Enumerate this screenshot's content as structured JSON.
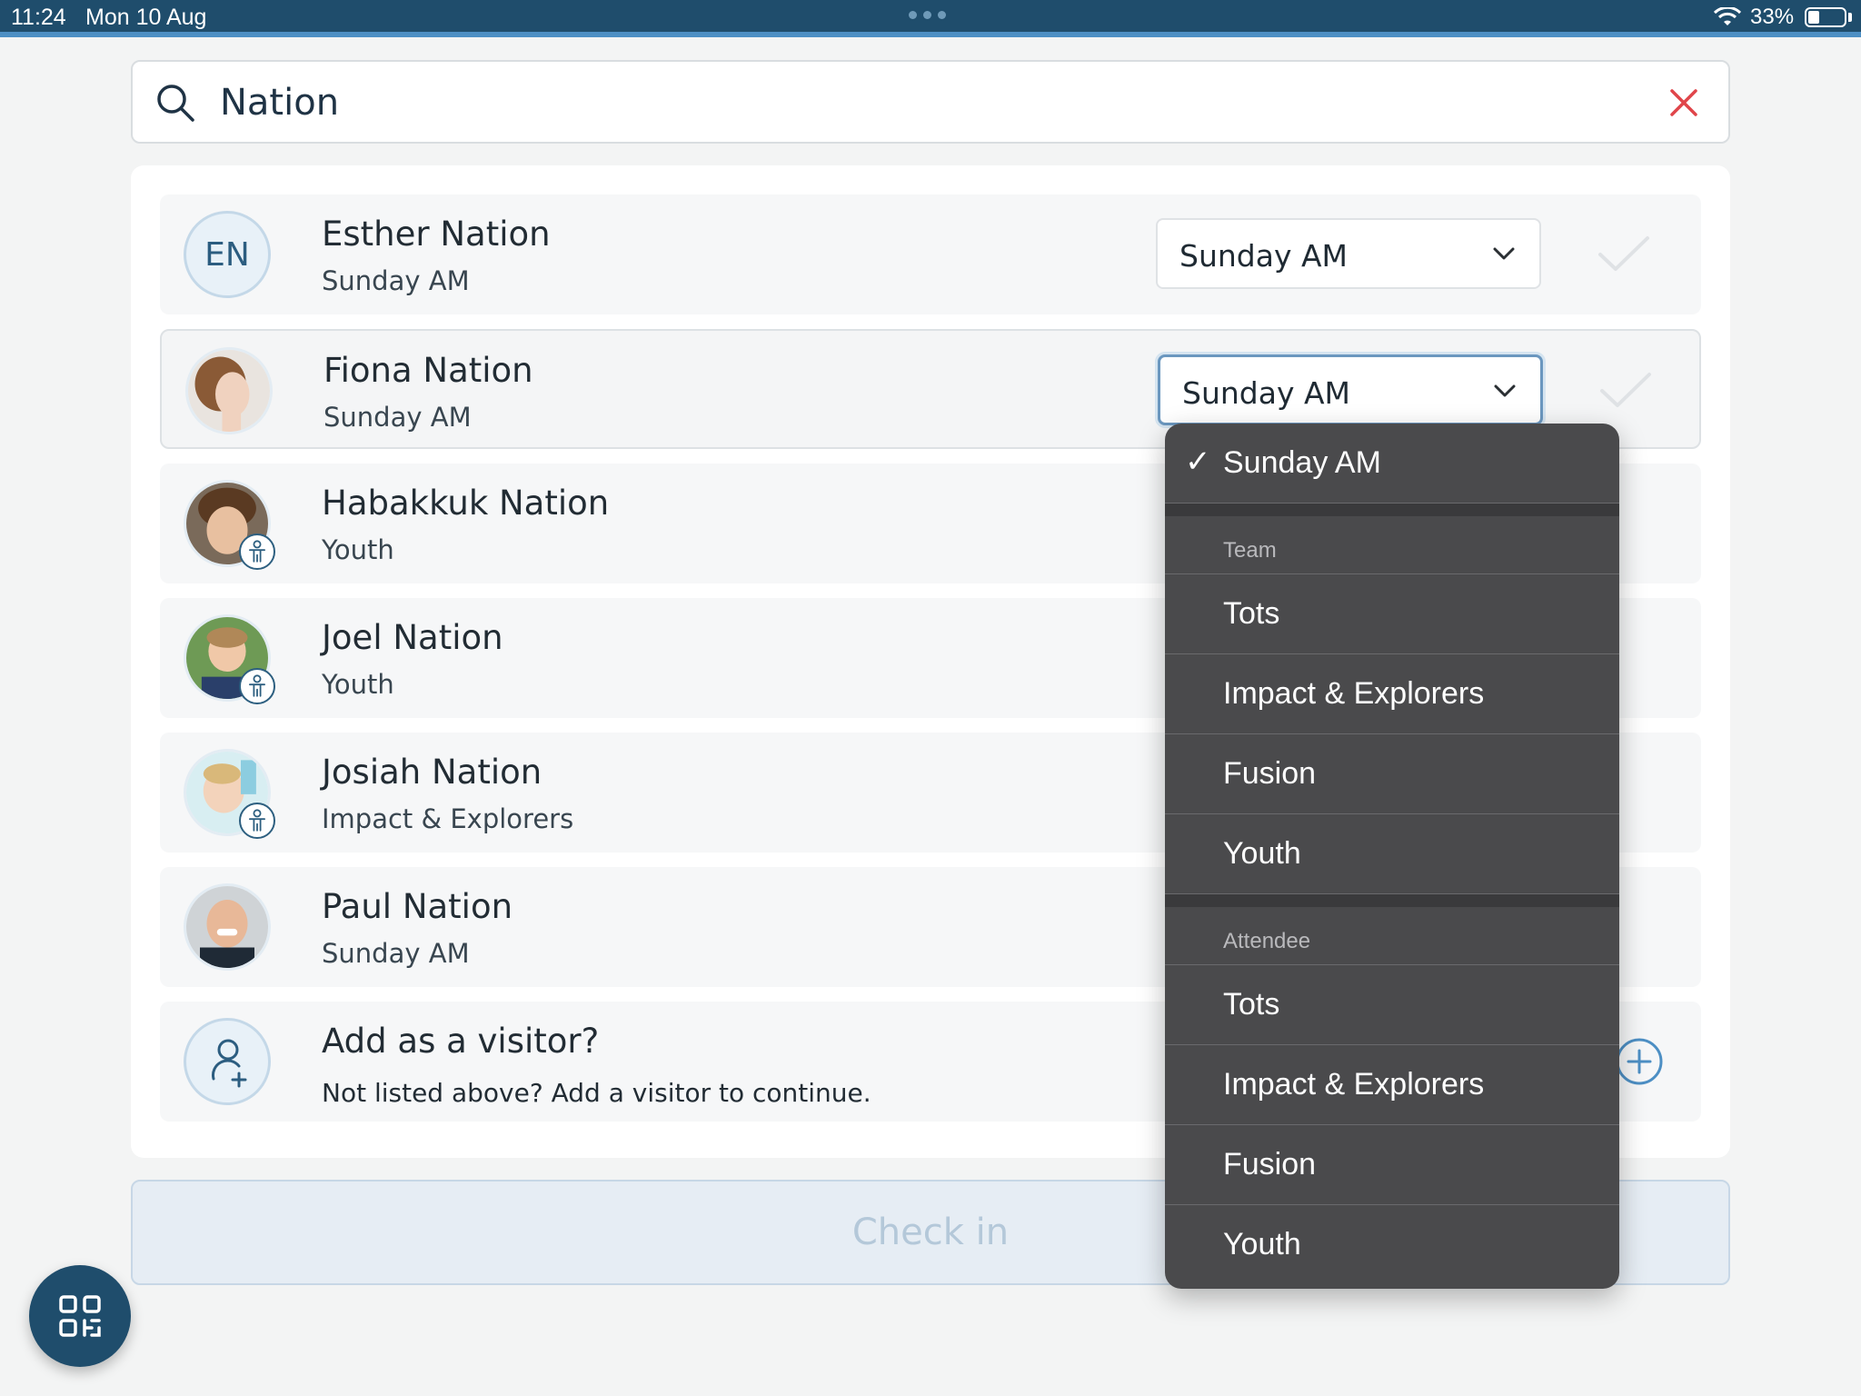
{
  "status_bar": {
    "time": "11:24",
    "date": "Mon 10 Aug",
    "battery": "33%"
  },
  "search": {
    "value": "Nation"
  },
  "people": [
    {
      "initials": "EN",
      "name": "Esther Nation",
      "group": "Sunday AM",
      "selected_service": "Sunday AM"
    },
    {
      "name": "Fiona Nation",
      "group": "Sunday AM",
      "selected_service": "Sunday AM"
    },
    {
      "name": "Habakkuk Nation",
      "group": "Youth"
    },
    {
      "name": "Joel Nation",
      "group": "Youth"
    },
    {
      "name": "Josiah Nation",
      "group": "Impact & Explorers"
    },
    {
      "name": "Paul Nation",
      "group": "Sunday AM"
    }
  ],
  "visitor": {
    "title": "Add as a visitor?",
    "subtitle": "Not listed above? Add a visitor to continue."
  },
  "checkin_label": "Check in",
  "dropdown": {
    "selected": "Sunday AM",
    "sections": [
      {
        "header": "Team",
        "items": [
          "Tots",
          "Impact & Explorers",
          "Fusion",
          "Youth"
        ]
      },
      {
        "header": "Attendee",
        "items": [
          "Tots",
          "Impact & Explorers",
          "Fusion",
          "Youth"
        ]
      }
    ]
  },
  "colors": {
    "primary": "#1f4d6c",
    "accent": "#4d8fc4",
    "clear": "#e0454a",
    "menu_bg": "#4a4a4c"
  }
}
